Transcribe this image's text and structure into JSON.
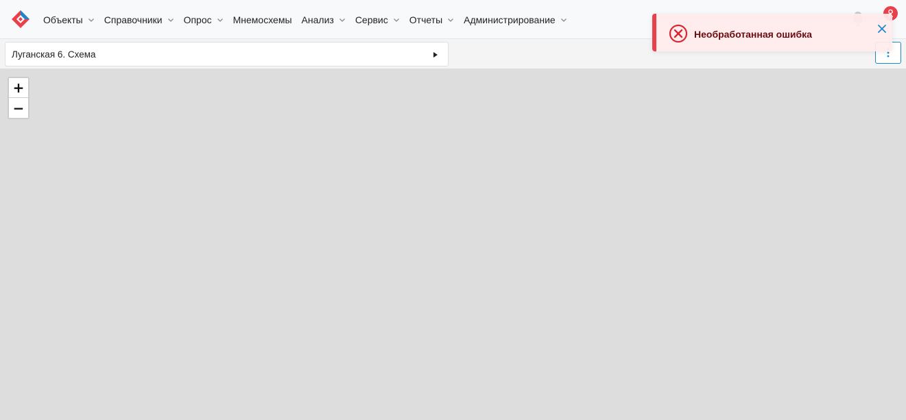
{
  "header": {
    "logo_icon": "app-logo-icon",
    "brand_colors": [
      "#e8414b",
      "#1e88c7"
    ],
    "nav": [
      {
        "label": "Объекты",
        "has_dropdown": true
      },
      {
        "label": "Справочники",
        "has_dropdown": true
      },
      {
        "label": "Опрос",
        "has_dropdown": true
      },
      {
        "label": "Мнемосхемы",
        "has_dropdown": false
      },
      {
        "label": "Анализ",
        "has_dropdown": true
      },
      {
        "label": "Сервис",
        "has_dropdown": true
      },
      {
        "label": "Отчеты",
        "has_dropdown": true
      },
      {
        "label": "Администрирование",
        "has_dropdown": true
      }
    ],
    "notifications_icon": "bell-icon",
    "user_icon": "user-icon",
    "user_badge_color": "#e8414b"
  },
  "toolbar": {
    "breadcrumb": "Луганская 6. Схема",
    "breadcrumb_arrow_icon": "caret-right-icon",
    "more_icon": "vertical-dots-icon"
  },
  "map": {
    "zoom_in_label": "+",
    "zoom_out_label": "−",
    "background": "#dddddd"
  },
  "toast": {
    "type": "error",
    "message": "Необработанная ошибка",
    "icon": "error-circle-icon",
    "close_icon": "close-icon",
    "accent_color": "#e8414b",
    "close_color": "#1e88c7"
  }
}
